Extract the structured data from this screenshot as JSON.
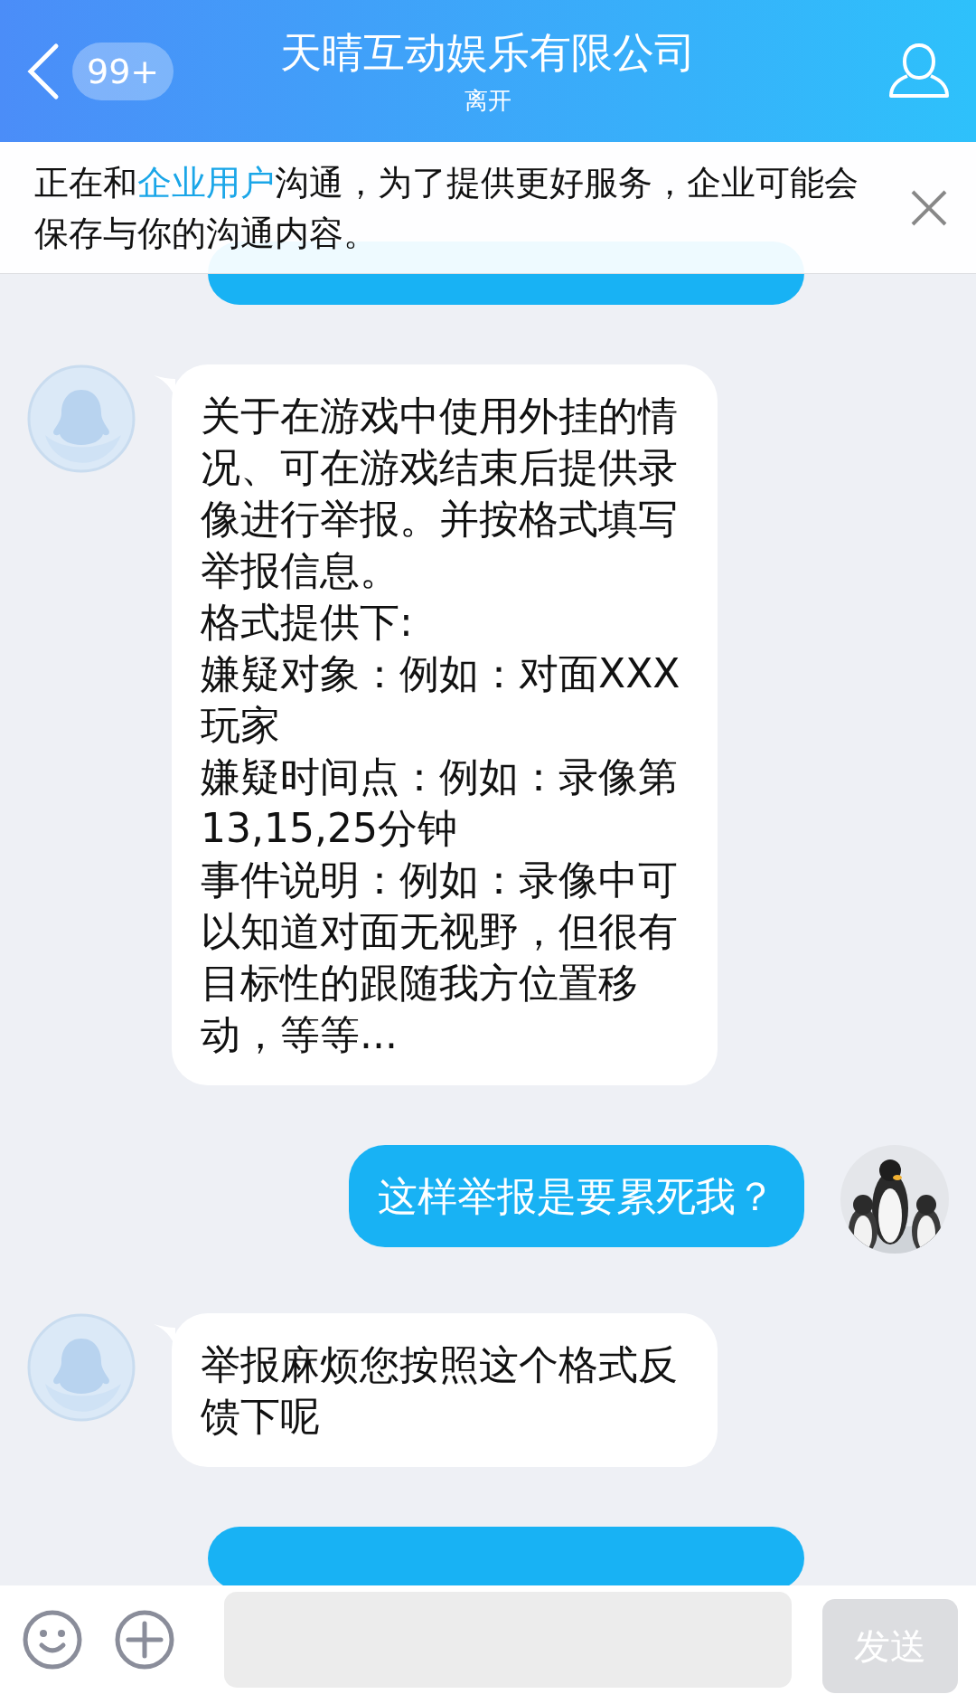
{
  "header": {
    "back_badge": "99+",
    "title": "天晴互动娱乐有限公司",
    "status": "离开"
  },
  "notice": {
    "before": "正在和",
    "link": "企业用户",
    "after": "沟通，为了提供更好服务，企业可能会保存与你的沟通内容。"
  },
  "messages": [
    {
      "kind": "clipped"
    },
    {
      "kind": "incoming",
      "lines": [
        "关于在游戏中使用外挂的情况、可在游戏结束后提供录像进行举报。并按格式填写举报信息。",
        "格式提供下:",
        "嫌疑对象：例如：对面XXX玩家",
        "嫌疑时间点：例如：录像第13,15,25分钟",
        "事件说明：例如：录像中可以知道对面无视野，但很有目标性的跟随我方位置移动，等等..."
      ]
    },
    {
      "kind": "outgoing",
      "lines": [
        "这样举报是要累死我？"
      ]
    },
    {
      "kind": "incoming",
      "lines": [
        "举报麻烦您按照这个格式反馈下呢"
      ]
    },
    {
      "kind": "clipped"
    }
  ],
  "input": {
    "send": "发送"
  }
}
